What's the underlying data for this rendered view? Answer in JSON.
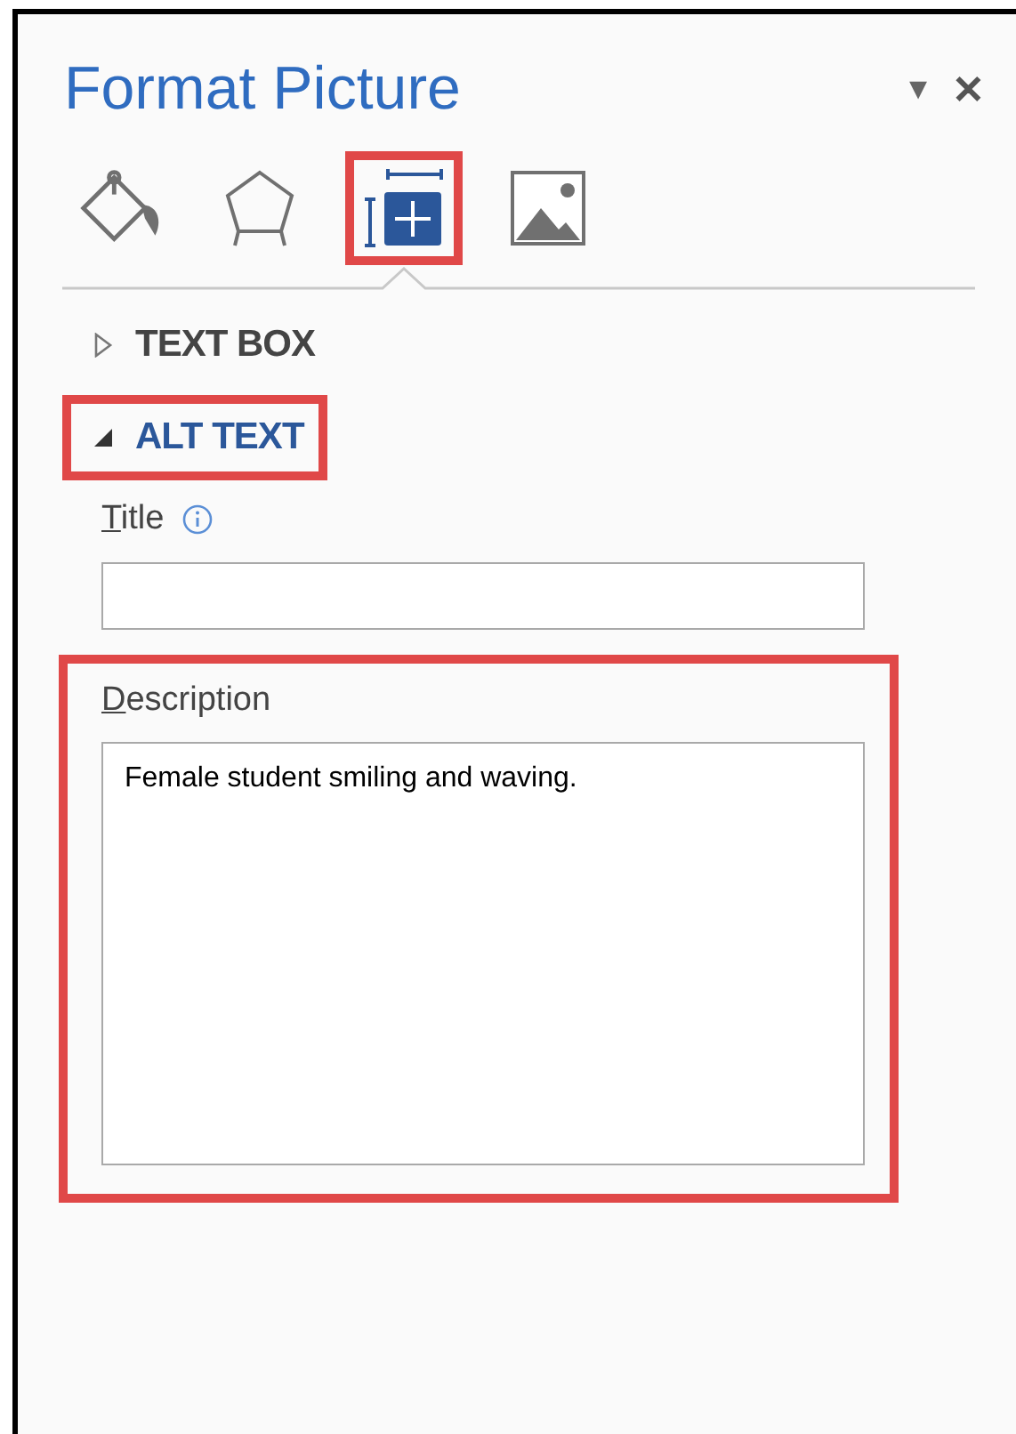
{
  "pane": {
    "title": "Format Picture",
    "menu_glyph": "▾",
    "close_glyph": "✕"
  },
  "tabs": [
    {
      "kind": "fill",
      "selected": false,
      "highlighted": false
    },
    {
      "kind": "effects",
      "selected": false,
      "highlighted": false
    },
    {
      "kind": "layout",
      "selected": true,
      "highlighted": true
    },
    {
      "kind": "picture",
      "selected": false,
      "highlighted": false
    }
  ],
  "sections": [
    {
      "label": "TEXT BOX",
      "expanded": false,
      "highlighted": false
    },
    {
      "label": "ALT TEXT",
      "expanded": true,
      "highlighted": true
    }
  ],
  "alt_text": {
    "title_field": {
      "label": "Title",
      "access_key_underlined": true,
      "info": true
    },
    "description_field": {
      "label": "Description",
      "access_key_underlined": true,
      "value": "Female student smiling and waving.",
      "highlighted": true
    }
  }
}
